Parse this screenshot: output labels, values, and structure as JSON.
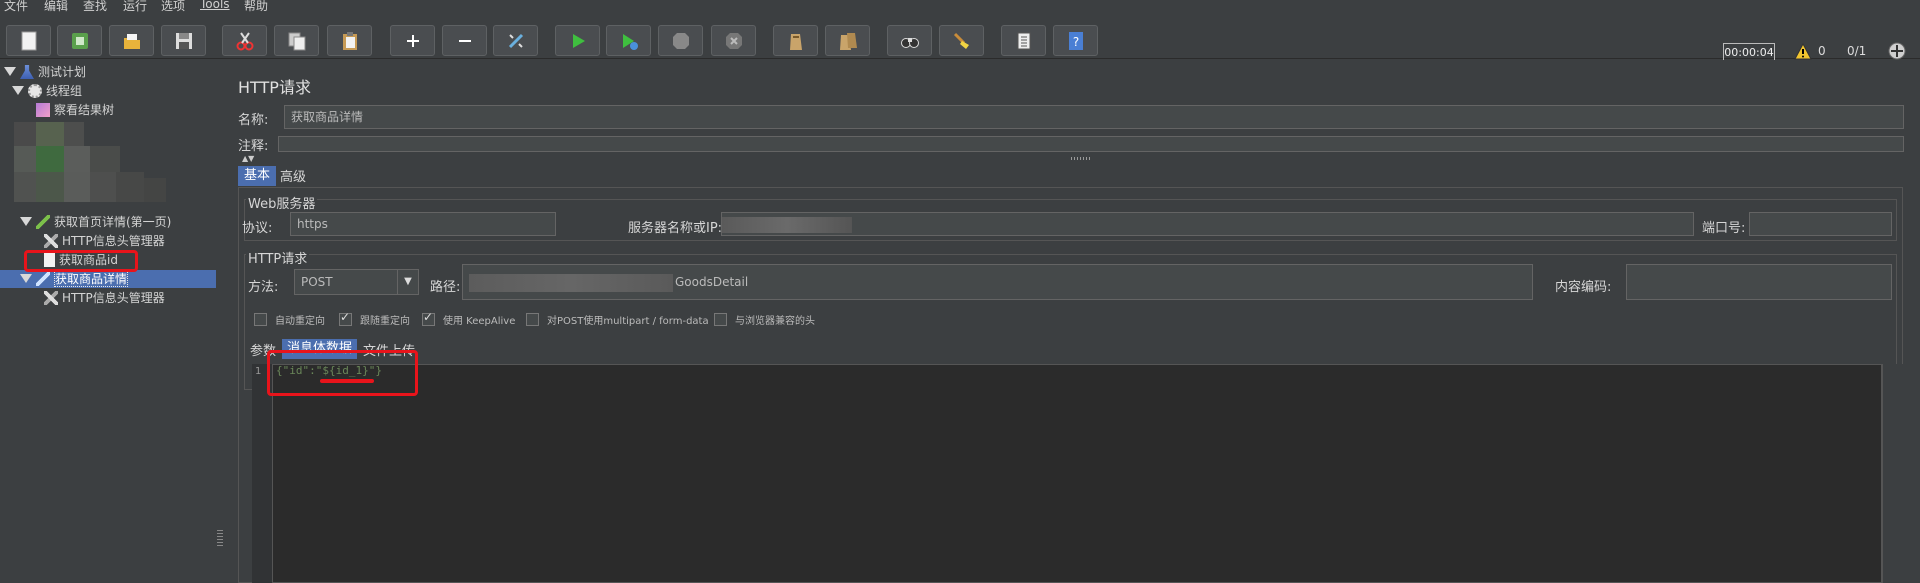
{
  "menu": [
    "文件",
    "编辑",
    "查找",
    "运行",
    "选项",
    "Tools",
    "帮助"
  ],
  "toolbar": {
    "timer": "00:00:04",
    "warnings": "0",
    "threads": "0/1",
    "icons": [
      "new-icon",
      "template-icon",
      "open-icon",
      "save-icon",
      "cut-icon",
      "copy-icon",
      "paste-icon",
      "expand-icon",
      "collapse-icon",
      "toggle-icon",
      "start-icon",
      "start-no-pause-icon",
      "stop-icon",
      "shutdown-icon",
      "clear-icon",
      "clear-all-icon",
      "search-icon",
      "reset-search-icon",
      "function-helper-icon",
      "help-icon"
    ]
  },
  "tree": {
    "test_plan": "测试计划",
    "thread_group": "线程组",
    "view_results": "察看结果树",
    "sampler_home": "获取首页详情(第一页)",
    "header_manager_1": "HTTP信息头管理器",
    "extract_id": "获取商品id",
    "sampler_detail": "获取商品详情",
    "header_manager_2": "HTTP信息头管理器"
  },
  "panel": {
    "title": "HTTP请求",
    "name_label": "名称:",
    "name_value": "获取商品详情",
    "comment_label": "注释:",
    "tabs": [
      "基本",
      "高级"
    ],
    "web_server_group": "Web服务器",
    "protocol_label": "协议:",
    "protocol_value": "https",
    "server_label": "服务器名称或IP:",
    "port_label": "端口号:",
    "http_request_group": "HTTP请求",
    "method_label": "方法:",
    "method_value": "POST",
    "path_label": "路径:",
    "path_value": "GoodsDetail",
    "encoding_label": "内容编码:",
    "checkboxes": [
      {
        "label": "自动重定向",
        "checked": false
      },
      {
        "label": "跟随重定向",
        "checked": true
      },
      {
        "label": "使用 KeepAlive",
        "checked": true
      },
      {
        "label": "对POST使用multipart / form-data",
        "checked": false
      },
      {
        "label": "与浏览器兼容的头",
        "checked": false
      }
    ],
    "body_tabs": [
      "参数",
      "消息体数据",
      "文件上传"
    ],
    "line_number": "1",
    "body_text": "{\"id\":\"${id_1}\"}"
  }
}
